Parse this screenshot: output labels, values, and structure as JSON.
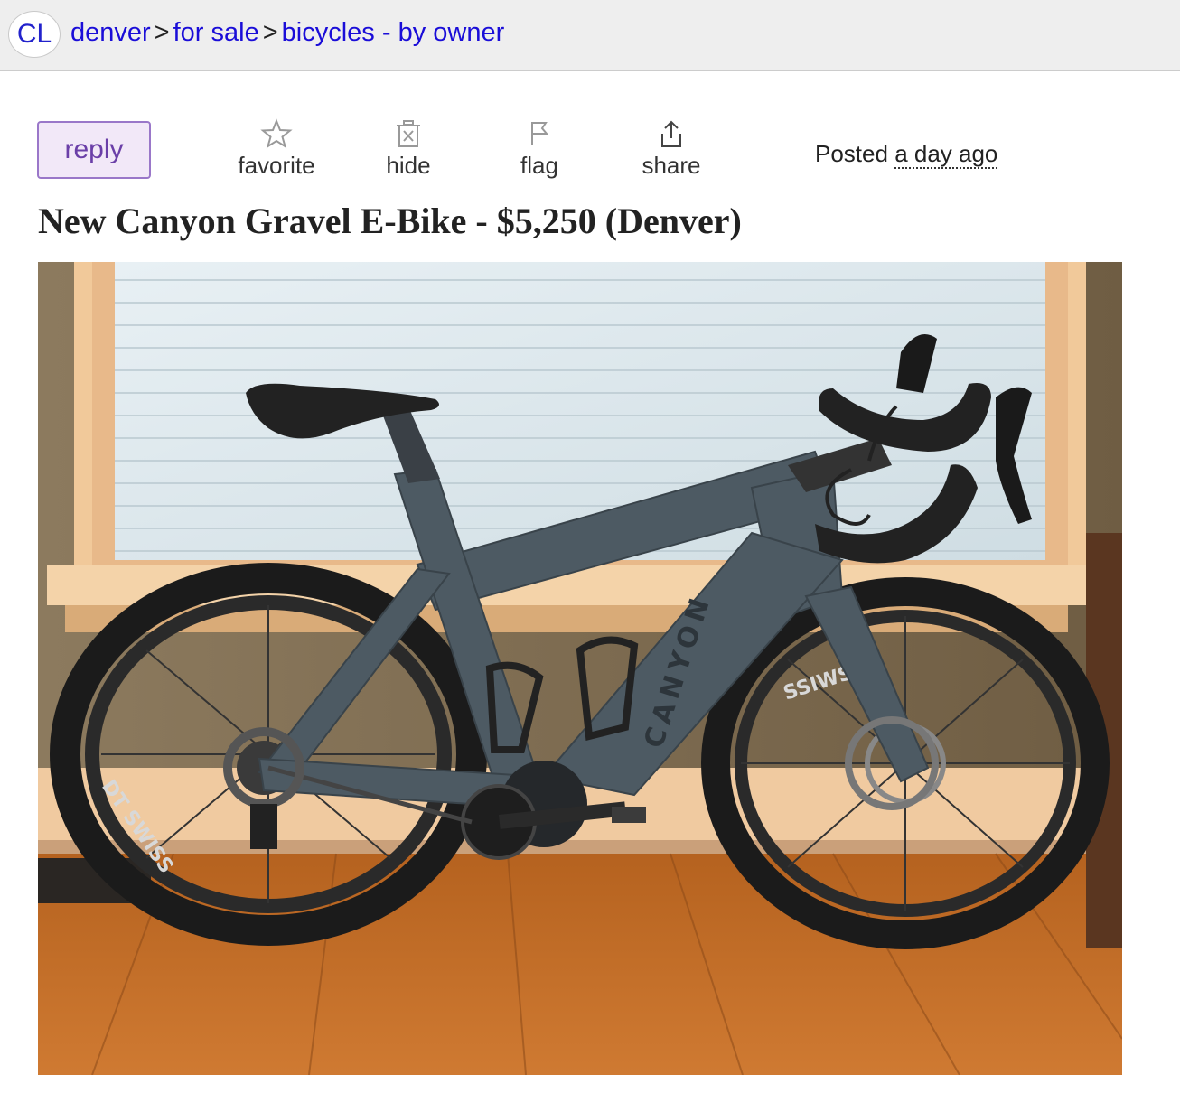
{
  "header": {
    "logo": "CL",
    "breadcrumbs": [
      {
        "label": "denver"
      },
      {
        "label": "for sale"
      },
      {
        "label": "bicycles - by owner"
      }
    ],
    "separator": ">"
  },
  "actions": {
    "reply": "reply",
    "favorite": "favorite",
    "hide": "hide",
    "flag": "flag",
    "share": "share"
  },
  "posted": {
    "prefix": "Posted",
    "ago": "a day ago"
  },
  "posting": {
    "title": "New Canyon Gravel E-Bike - $5,250 (Denver)"
  },
  "photo": {
    "frame_text": "CANYON",
    "rear_rim_text": "DT SWISS",
    "front_rim_text": "SSIWS",
    "icons": [
      "star-icon",
      "trash-x-icon",
      "flag-icon",
      "share-icon"
    ]
  },
  "colors": {
    "link": "#1a0dd8",
    "reply_bg": "#f2e8f8",
    "reply_border": "#9a77c9",
    "reply_text": "#6b3fa8",
    "topbar_bg": "#eeeeee"
  }
}
